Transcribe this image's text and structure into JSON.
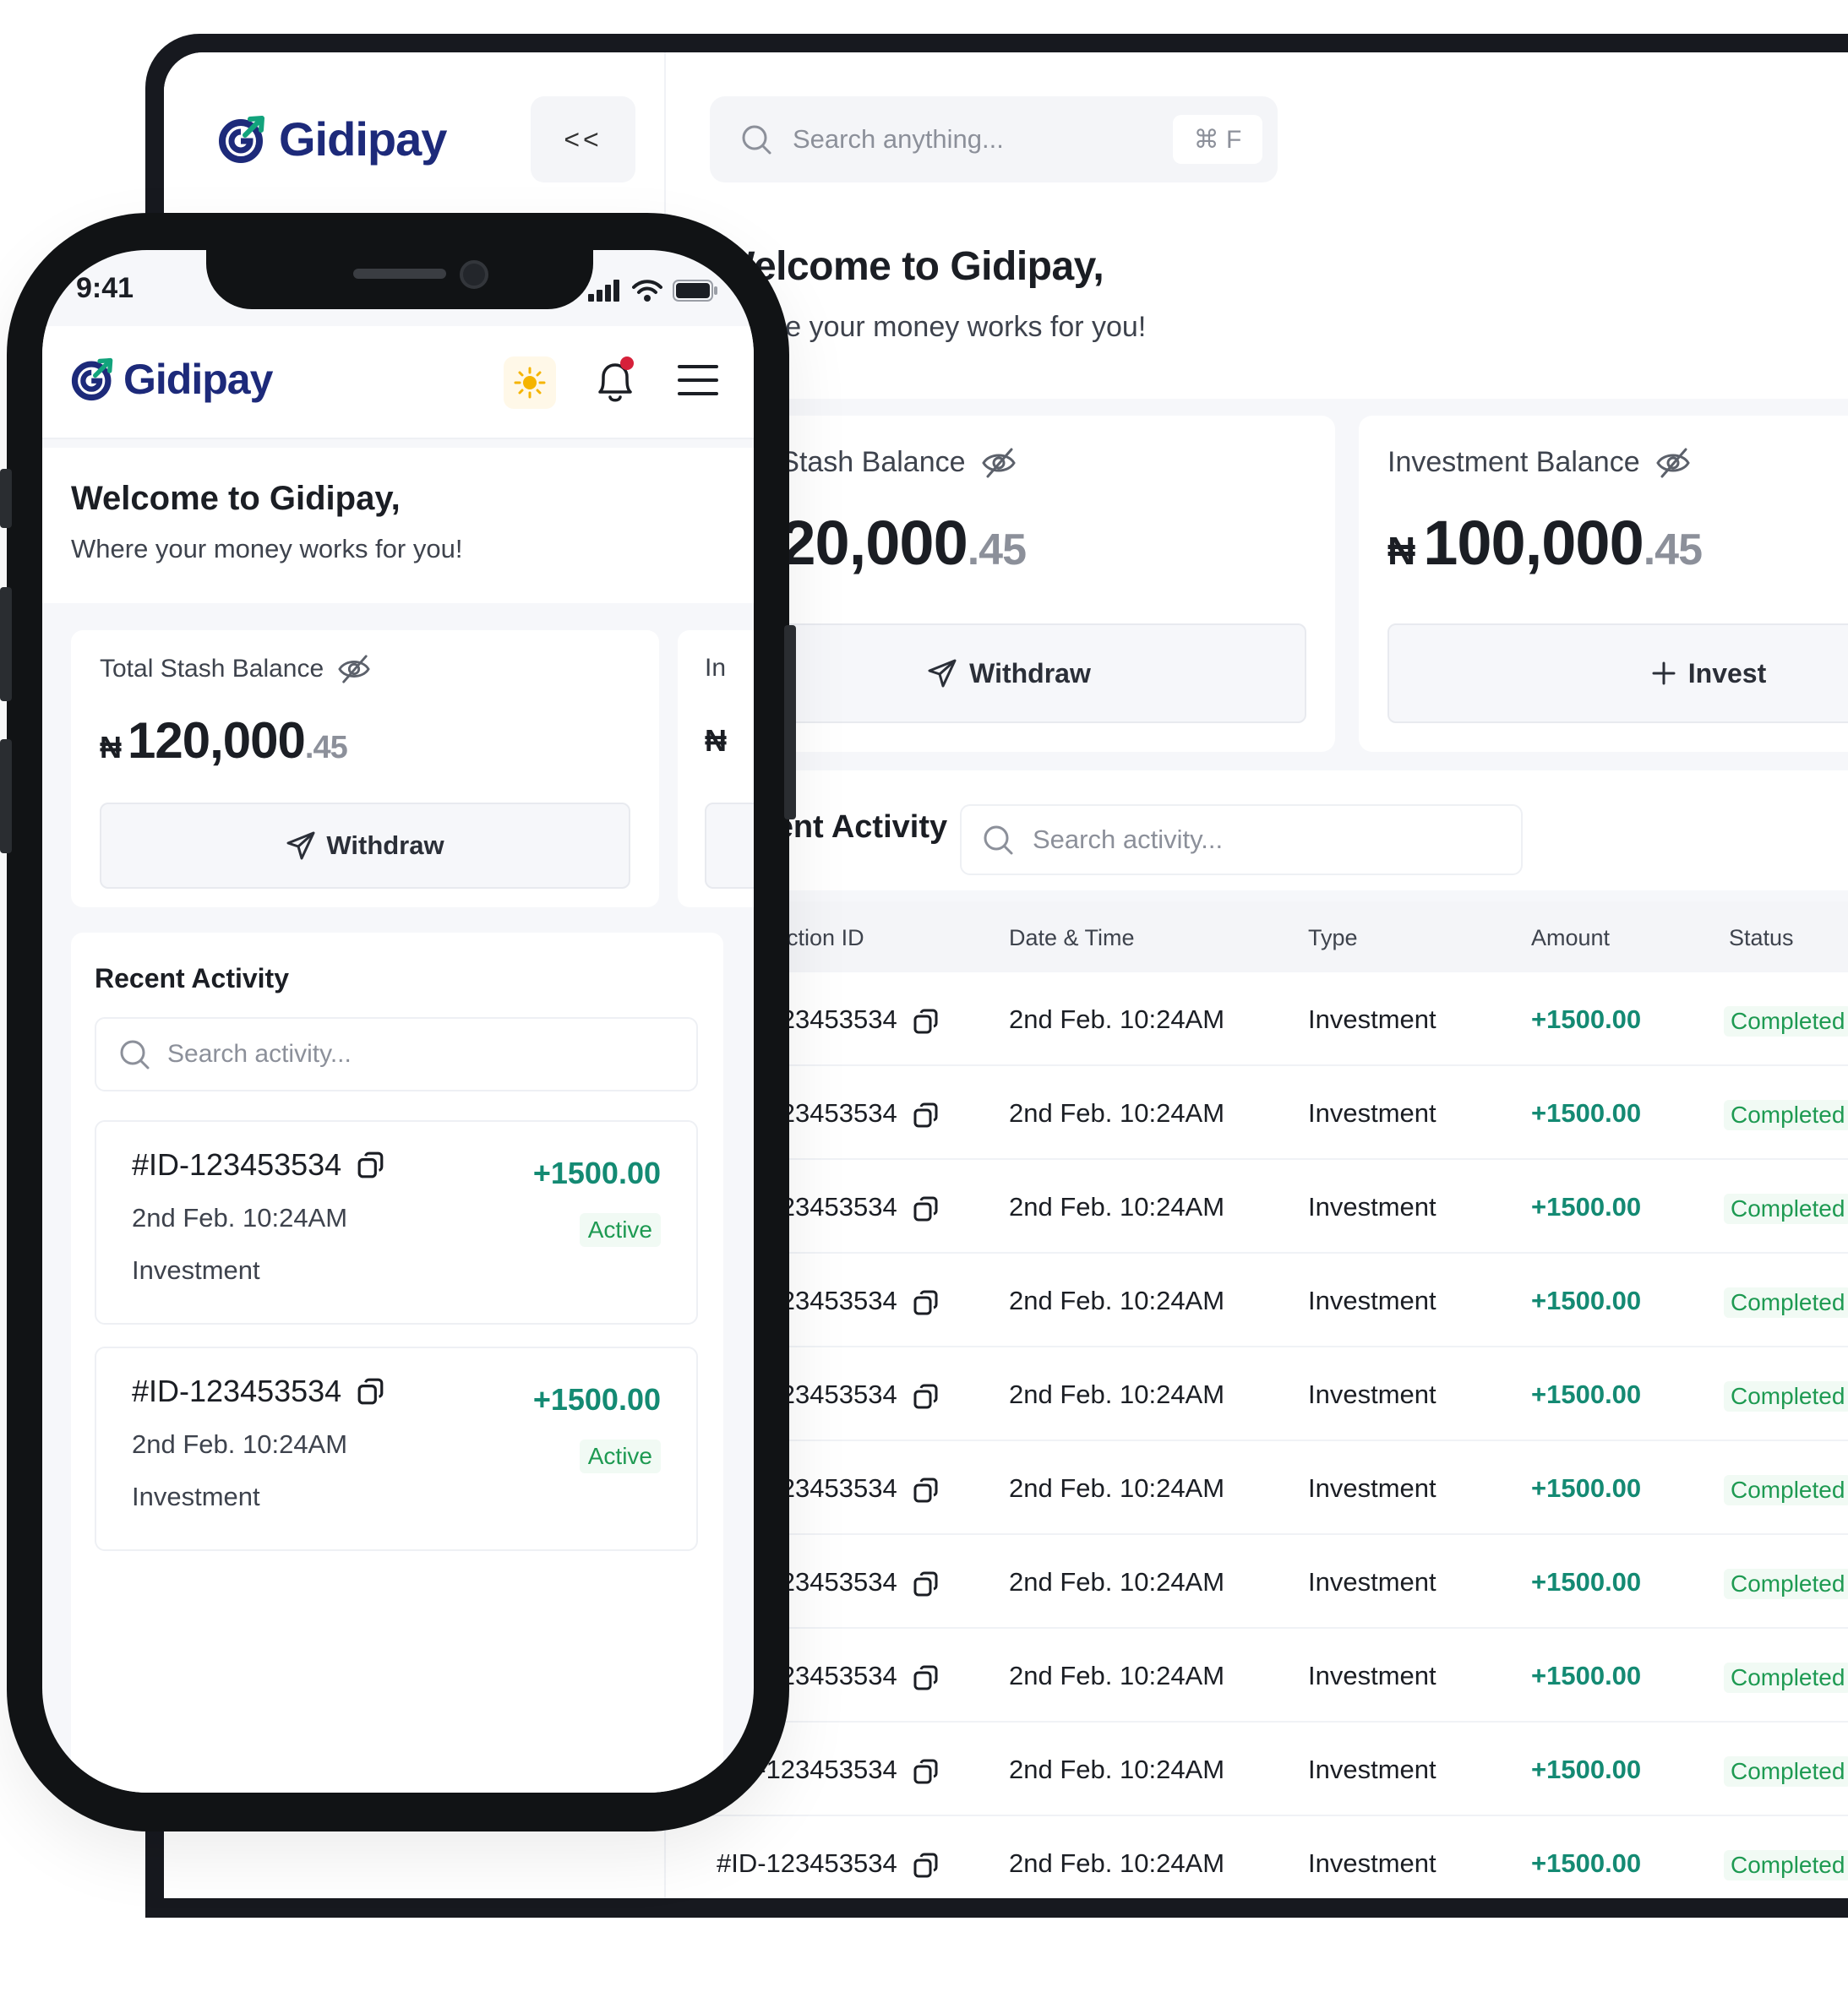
{
  "brand": {
    "name": "Gidipay",
    "primary": "#1d2a7a",
    "accent": "#12a37c"
  },
  "desktop": {
    "collapse_label": "<<",
    "search": {
      "placeholder": "Search anything...",
      "shortcut": "⌘ F"
    },
    "welcome": {
      "title": "Welcome to Gidipay,",
      "subtitle": "Where your money works for you!"
    },
    "cards": [
      {
        "label": "Total Stash Balance",
        "currency": "₦",
        "amount": "120,000",
        "decimals": ".45",
        "action": "Withdraw",
        "action_icon": "send-icon"
      },
      {
        "label": "Investment Balance",
        "currency": "₦",
        "amount": "100,000",
        "decimals": ".45",
        "action": "Invest",
        "action_icon": "plus-icon"
      }
    ],
    "activity": {
      "title": "Recent Activity",
      "search_placeholder": "Search activity...",
      "columns": [
        "Transaction ID",
        "Date & Time",
        "Type",
        "Amount",
        "Status"
      ],
      "rows": [
        {
          "id": "#ID-123453534",
          "date": "2nd Feb.  10:24AM",
          "type": "Investment",
          "amount": "+1500.00",
          "status": "Completed"
        },
        {
          "id": "#ID-123453534",
          "date": "2nd Feb.  10:24AM",
          "type": "Investment",
          "amount": "+1500.00",
          "status": "Completed"
        },
        {
          "id": "#ID-123453534",
          "date": "2nd Feb.  10:24AM",
          "type": "Investment",
          "amount": "+1500.00",
          "status": "Completed"
        },
        {
          "id": "#ID-123453534",
          "date": "2nd Feb.  10:24AM",
          "type": "Investment",
          "amount": "+1500.00",
          "status": "Completed"
        },
        {
          "id": "#ID-123453534",
          "date": "2nd Feb.  10:24AM",
          "type": "Investment",
          "amount": "+1500.00",
          "status": "Completed"
        },
        {
          "id": "#ID-123453534",
          "date": "2nd Feb.  10:24AM",
          "type": "Investment",
          "amount": "+1500.00",
          "status": "Completed"
        },
        {
          "id": "#ID-123453534",
          "date": "2nd Feb.  10:24AM",
          "type": "Investment",
          "amount": "+1500.00",
          "status": "Completed"
        },
        {
          "id": "#ID-123453534",
          "date": "2nd Feb.  10:24AM",
          "type": "Investment",
          "amount": "+1500.00",
          "status": "Completed"
        },
        {
          "id": "#ID-123453534",
          "date": "2nd Feb.  10:24AM",
          "type": "Investment",
          "amount": "+1500.00",
          "status": "Completed"
        },
        {
          "id": "#ID-123453534",
          "date": "2nd Feb.  10:24AM",
          "type": "Investment",
          "amount": "+1500.00",
          "status": "Completed"
        }
      ]
    }
  },
  "mobile": {
    "time": "9:41",
    "welcome": {
      "title": "Welcome to Gidipay,",
      "subtitle": "Where your money works for you!"
    },
    "card": {
      "label": "Total Stash Balance",
      "currency": "₦",
      "amount": "120,000",
      "decimals": ".45",
      "action": "Withdraw"
    },
    "card2": {
      "label": "In",
      "currency": "₦"
    },
    "activity": {
      "title": "Recent Activity",
      "search_placeholder": "Search activity...",
      "items": [
        {
          "id": "#ID-123453534",
          "date": "2nd Feb.  10:24AM",
          "type": "Investment",
          "amount": "+1500.00",
          "status": "Active"
        },
        {
          "id": "#ID-123453534",
          "date": "2nd Feb.  10:24AM",
          "type": "Investment",
          "amount": "+1500.00",
          "status": "Active"
        }
      ]
    }
  }
}
